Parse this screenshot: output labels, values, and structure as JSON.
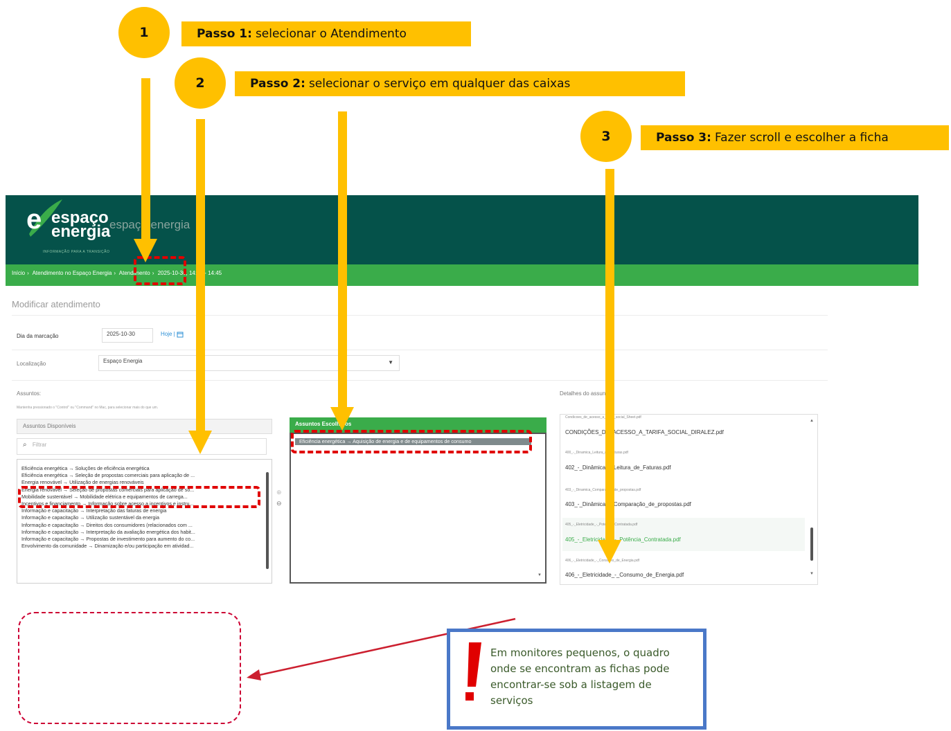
{
  "steps": [
    {
      "number": "1",
      "title": "Passo 1:",
      "text": "selecionar o Atendimento"
    },
    {
      "number": "2",
      "title": "Passo 2:",
      "text": "selecionar o serviço em qualquer das caixas"
    },
    {
      "number": "3",
      "title": "Passo 3:",
      "text": "Fazer scroll e escolher a ficha"
    }
  ],
  "app": {
    "logo": {
      "line1": "espaço",
      "line2": "energia",
      "tagline": "INFORMAÇÃO PARA A TRANSIÇÃO"
    },
    "header_title": "espaço energia",
    "breadcrumb": [
      "Início",
      "Atendimento no Espaço Energia",
      "Atendimento",
      "2025-10-30, 14:15 - 14:45"
    ],
    "page_title": "Modificar atendimento",
    "form": {
      "date_label": "Dia da marcação",
      "date_value": "2025-10-30",
      "today_link": "Hoje",
      "location_label": "Localização",
      "location_value": "Espaço Energia"
    },
    "subjects": {
      "label": "Assuntos:",
      "help": "Mantenha pressionado o \"Control\" ou \"Command\" no Mac, para selecionar mais do que um.",
      "available_title": "Assuntos Disponíveis",
      "filter_placeholder": "Filtrar",
      "available": [
        "Eficiência energética → Soluções de eficiência energética",
        "Eficiência energética → Seleção de propostas comerciais para aplicação de ...",
        "Energia renovável → Utilização de energias renováveis",
        "Energia renovável → Seleção de propostas comerciais para aplicação de so...",
        "Mobilidade sustentável → Mobilidade elétrica e equipamentos de carrega...",
        "Incentivos e financiamento → Informação sobre acesso a incentivos e instru...",
        "Informação e capacitação → Interpretação das faturas de energia",
        "Informação e capacitação → Utilização sustentável da energia",
        "Informação e capacitação → Direitos dos consumidores (relacionados com ...",
        "Informação e capacitação → Interpretação da avaliação energética dos habit...",
        "Informação e capacitação → Propostas de investimento para aumento do co...",
        "Envolvimento da comunidade → Dinamização e/ou participação em atividad..."
      ],
      "chosen_title": "Assuntos Escolhidos",
      "chosen": [
        "Eficiência energética → Aquisição de energia e de equipamentos de consumo"
      ]
    },
    "details": {
      "label": "Detalhes do assunto:",
      "files": [
        {
          "small": "Condicoes_de_acesso_a_tarifa_social_Sheet.pdf",
          "name": "CONDIÇÕES_DE_ACESSO_A_TARIFA_SOCIAL_DIRALEZ.pdf",
          "color": "#333333"
        },
        {
          "small": "400_-_Dinamica_Leitura_de_Faturas.pdf",
          "name": "402_-_Dinâmica_-_Leitura_de_Faturas.pdf",
          "color": "#333333"
        },
        {
          "small": "403_-_Dinamica_Comparacao_de_propostas.pdf",
          "name": "403_-_Dinâmica_-_Comparação_de_propostas.pdf",
          "color": "#333333"
        },
        {
          "small": "405_-_Eletricidade_-_Potencia_Contratada.pdf",
          "name": "405_-_Eletricidade_-_Potência_Contratada.pdf",
          "color": "#3aac4a"
        },
        {
          "small": "406_-_Eletricidade_-_Consumo_de_Energia.pdf",
          "name": "406_-_Eletricidade_-_Consumo_de_Energia.pdf",
          "color": "#333333"
        }
      ]
    }
  },
  "warning": {
    "mark": "!",
    "text": "Em monitores pequenos, o quadro onde se encontram as fichas pode encontrar-se sob a listagem de serviços"
  },
  "colors": {
    "step_yellow": "#ffc000",
    "header_green": "#05524a",
    "bar_green": "#3aac4a",
    "annotation_red": "#e00000",
    "warning_border": "#4a78c8"
  }
}
